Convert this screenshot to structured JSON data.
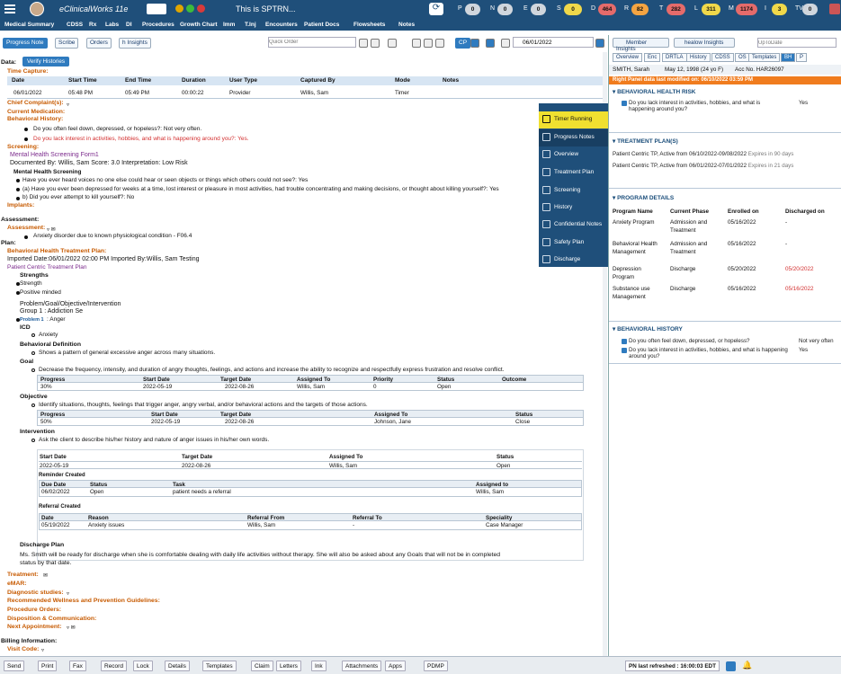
{
  "app": {
    "title": "eClinicalWorks 11e",
    "center_title": "This is SPTRN...",
    "dots": [
      {
        "color": "#e0a600"
      },
      {
        "color": "#3cbb3c"
      },
      {
        "color": "#d83a3a"
      }
    ],
    "counters": [
      {
        "key": "P",
        "value": "0",
        "color": "#d0d6dd"
      },
      {
        "key": "N",
        "value": "0",
        "color": "#d0d6dd"
      },
      {
        "key": "E",
        "value": "0",
        "color": "#d0d6dd"
      },
      {
        "key": "S",
        "value": "0",
        "color": "#f0d84a"
      },
      {
        "key": "D",
        "value": "464",
        "color": "#e56b6b"
      },
      {
        "key": "R",
        "value": "82",
        "color": "#f4a442"
      },
      {
        "key": "T",
        "value": "282",
        "color": "#e56b6b"
      },
      {
        "key": "L",
        "value": "311",
        "color": "#f0d84a"
      },
      {
        "key": "M",
        "value": "1174",
        "color": "#e56b6b"
      },
      {
        "key": "I",
        "value": "3",
        "color": "#f0d84a"
      },
      {
        "key": "TV",
        "value": "0",
        "color": "#d0d6dd"
      }
    ]
  },
  "menu": [
    "Medical Summary",
    "CDSS",
    "Rx",
    "Labs",
    "DI",
    "Procedures",
    "Growth Chart",
    "Imm",
    "T.Inj",
    "Encounters",
    "Patient Docs",
    "Flowsheets",
    "Notes"
  ],
  "toolbar": {
    "progress_note": "Progress Note",
    "scribe": "Scribe",
    "orders": "Orders",
    "insights": "h Insights",
    "quick_order_placeholder": "Quick Order",
    "cp": "CP",
    "date": "06/01/2022"
  },
  "note": {
    "data_label": "Data:",
    "verify_btn": "Verify Histories",
    "time_capture": "Time Capture:",
    "time_headers": [
      "Date",
      "Start Time",
      "End Time",
      "Duration",
      "User Type",
      "Captured By",
      "Mode",
      "Notes"
    ],
    "time_row": [
      "06/01/2022",
      "05:48 PM",
      "05:49 PM",
      "00:00:22",
      "Provider",
      "Willis, Sam",
      "Timer",
      ""
    ],
    "chief_complaint": "Chief Complaint(s):",
    "current_medication": "Current Medication:",
    "behavioral_history": "Behavioral History:",
    "bh_item1": "Do you often feel down, depressed, or hopeless?: Not very often.",
    "bh_item2": "Do you lack interest in activities, hobbies, and what is happening around you?: Yes.",
    "screening": "Screening:",
    "screen_form": "Mental Health Screening Form1",
    "documented_by": "Documented By: Willis, Sam Score: 3.0 Interpretation: Low Risk",
    "mh_screening": "Mental Health Screening",
    "ms1": "Have you ever heard voices no one else could hear or seen objects or things which others could not see?: Yes",
    "ms2": "(a) Have you ever been depressed for weeks at a time, lost interest or pleasure in most activities, had trouble concentrating and making decisions, or thought about killing yourself?: Yes",
    "ms3": "b) Did you ever attempt to kill yourself?: No",
    "implants": "Implants:",
    "assessment_h": "Assessment:",
    "assessment": "Assessment:",
    "assessment_item": "Anxiety disorder due to known physiological condition - F06.4",
    "plan_h": "Plan:",
    "bh_treatment": "Behavioral Health Treatment Plan:",
    "imported": "Imported Date:06/01/2022 02:00 PM  Imported By:Willis, Sam Testing",
    "pc_treatment": "Patient Centric Treatment Plan",
    "strengths": "Strengths",
    "strength1": "Strength",
    "strength2": "Positive minded",
    "pgoi": "Problem/Goal/Objective/Intervention",
    "group": "Group 1 : Addiction Se",
    "problem_lbl": "Problem 1",
    "problem_val": ": Anger",
    "icd": "ICD",
    "icd_item": "Anxiety",
    "behavioral_def": "Behavioral Definition",
    "bd_item": "Shows a pattern of general excessive anger across many situations.",
    "goal": "Goal",
    "goal_item": "Decrease the frequency, intensity, and duration of angry thoughts, feelings, and actions and increase the ability to recognize and respectfully express frustration and resolve conflict.",
    "goal_headers": [
      "Progress",
      "Start Date",
      "Target Date",
      "Assigned To",
      "Priority",
      "Status",
      "Outcome"
    ],
    "goal_row": [
      "30%",
      "2022-05-19",
      "2022-08-26",
      "Willis, Sam",
      "0",
      "Open",
      ""
    ],
    "objective": "Objective",
    "obj_item": "Identify situations, thoughts, feelings that trigger anger, angry verbal, and/or behavioral actions and the targets of those actions.",
    "obj_headers": [
      "Progress",
      "Start Date",
      "Target Date",
      "Assigned To",
      "Status"
    ],
    "obj_row": [
      "50%",
      "2022-05-19",
      "2022-08-26",
      "Johnson, Jane",
      "Close"
    ],
    "intervention": "Intervention",
    "int_item": "Ask the client to describe his/her history and nature of anger issues in his/her own words.",
    "int_headers": [
      "Start Date",
      "Target Date",
      "Assigned To",
      "Status"
    ],
    "int_row": [
      "2022-05-19",
      "2022-08-26",
      "Willis, Sam",
      "Open"
    ],
    "reminder_created": "Reminder Created",
    "rem_headers": [
      "Due Date",
      "Status",
      "Task",
      "Assigned to"
    ],
    "rem_row": [
      "06/02/2022",
      "Open",
      "patient needs a referral",
      "Willis, Sam"
    ],
    "referral_created": "Referral Created",
    "ref_headers": [
      "Date",
      "Reason",
      "Referral From",
      "Referral To",
      "Speciality"
    ],
    "ref_row": [
      "05/19/2022",
      "Anxiety issues",
      "Willis, Sam",
      "-",
      "Case Manager"
    ],
    "discharge_plan": "Discharge Plan",
    "discharge_text1": "Ms. Smith will be ready for discharge when she is comfortable dealing with daily life activities without therapy. She will also be asked about any Goals that will not be in completed",
    "discharge_text2": "status by that date.",
    "treatment": "Treatment:",
    "emar": "eMAR:",
    "diagnostic": "Diagnostic studies:",
    "wellness": "Recommended Wellness and Prevention Guidelines:",
    "procedure_orders": "Procedure Orders:",
    "disposition": "Disposition & Communication:",
    "next_appt": "Next Appointment:",
    "billing": "Billing Information:",
    "visit_code": "Visit Code:"
  },
  "side_menu": [
    "Timer Running",
    "Progress Notes",
    "Overview",
    "Treatment Plan",
    "Screening",
    "History",
    "Confidential Notes",
    "Safety Plan",
    "Discharge"
  ],
  "right": {
    "member_insights": "Member Insights",
    "healow": "healow Insights",
    "uptodate": "UpToDate",
    "tabs": [
      "Overview",
      "Enc",
      "DRTLA",
      "History",
      "CDSS",
      "OS",
      "Templates",
      "BH",
      "P"
    ],
    "patient": "SMITH, Sarah",
    "dob": "May 12, 1998 (24 yo F)",
    "acc": "Acc No. HAR26097",
    "updated": "Right Panel data last modified on: 06/10/2022 03:59 PM",
    "bh_risk": "BEHAVIORAL HEALTH RISK",
    "risk_q": "Do you lack interest in activities, hobbies, and what is happening around you?",
    "risk_a": "Yes",
    "treatment_plans": "TREATMENT PLAN(S)",
    "tp1": "Patient Centric TP, Active from 06/10/2022-09/08/2022",
    "tp1_exp": "Expires in 90 days",
    "tp2": "Patient Centric TP, Active from 06/01/2022-07/01/2022",
    "tp2_exp": "Expires in 21 days",
    "program_details": "PROGRAM DETAILS",
    "prog_headers": [
      "Program Name",
      "Current Phase",
      "Enrolled on",
      "Discharged on"
    ],
    "programs": [
      {
        "name1": "Anxiety Program",
        "name2": "",
        "phase1": "Admission and",
        "phase2": "Treatment",
        "enrolled": "05/16/2022",
        "discharged": "-",
        "red": false
      },
      {
        "name1": "Behavioral Health",
        "name2": "Management",
        "phase1": "Admission and",
        "phase2": "Treatment",
        "enrolled": "05/16/2022",
        "discharged": "-",
        "red": false
      },
      {
        "name1": "Depression",
        "name2": "Program",
        "phase1": "Discharge",
        "phase2": "",
        "enrolled": "05/20/2022",
        "discharged": "05/20/2022",
        "red": true
      },
      {
        "name1": "Substance use",
        "name2": "Management",
        "phase1": "Discharge",
        "phase2": "",
        "enrolled": "05/16/2022",
        "discharged": "05/16/2022",
        "red": true
      }
    ],
    "behavioral_history": "BEHAVIORAL HISTORY",
    "bh_q1": "Do you often feel down, depressed, or hopeless?",
    "bh_a1": "Not very often",
    "bh_q2": "Do you lack interest in activities, hobbies, and what is happening around you?",
    "bh_a2": "Yes"
  },
  "bottom": {
    "buttons": [
      "Send",
      "Print",
      "Fax",
      "Record",
      "Lock",
      "Details",
      "Templates",
      "Claim",
      "Letters",
      "Ink",
      "Attachments",
      "Apps",
      "PDMP"
    ],
    "pn_refreshed": "PN last refreshed : 16:00:03 EDT"
  }
}
